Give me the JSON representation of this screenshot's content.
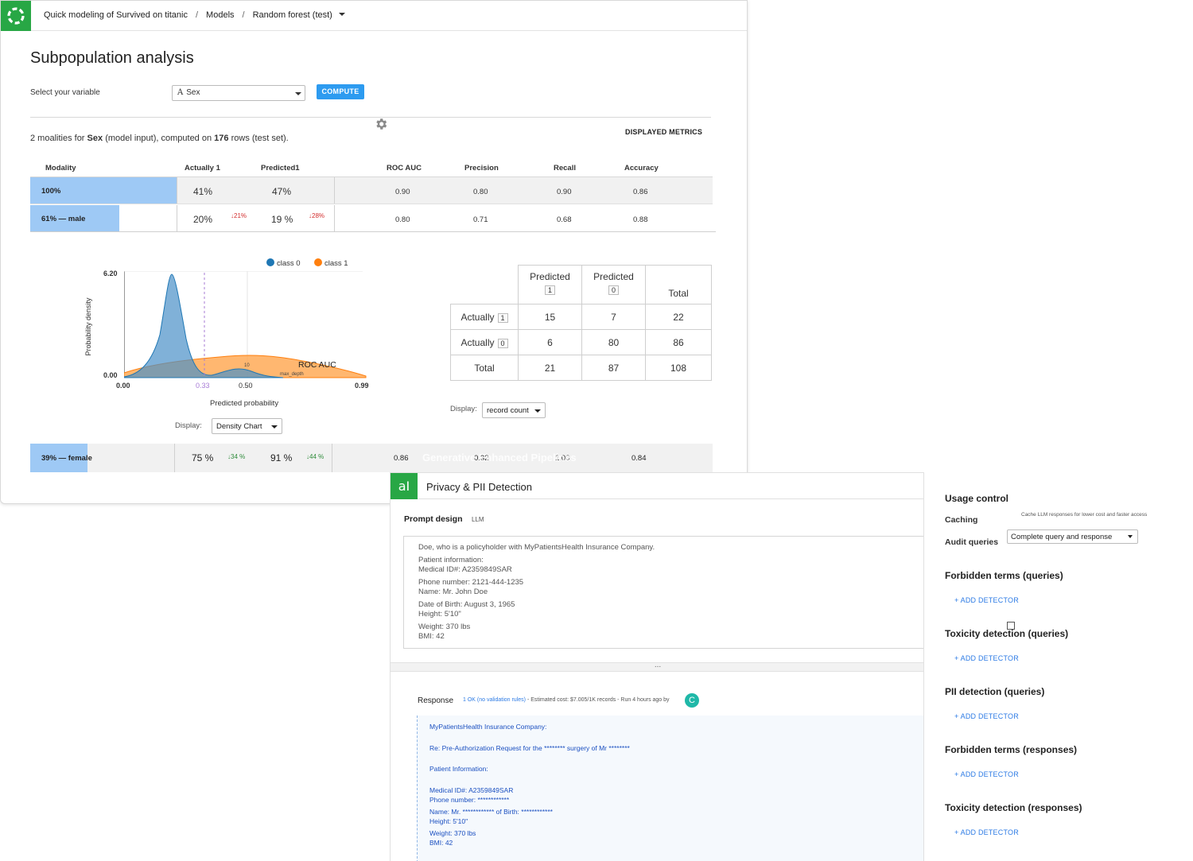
{
  "breadcrumb": {
    "project": "Quick modeling of Survived on titanic",
    "models": "Models",
    "model": "Random forest (test)"
  },
  "page_title": "Subpopulation analysis",
  "variable": {
    "label": "Select your variable",
    "selected": "Sex",
    "type_glyph": "A",
    "compute_label": "COMPUTE"
  },
  "displayed_metrics_label": "DISPLAYED METRICS",
  "summary": {
    "prefix": "2 moalities for",
    "variable": "Sex",
    "mid": "(model input), computed on",
    "rows": "176",
    "suffix": "rows (test set)."
  },
  "table": {
    "headers": [
      "Modality",
      "Actually 1",
      "Predicted1",
      "ROC AUC",
      "Precision",
      "Recall",
      "Accuracy"
    ],
    "rows": [
      {
        "modality": "100%",
        "share": 1.0,
        "actually1": "41%",
        "predicted1": "47%",
        "d_act": "",
        "d_pred": "",
        "roc_auc": "0.90",
        "precision": "0.80",
        "recall": "0.90",
        "accuracy": "0.86"
      },
      {
        "modality": "61% — male",
        "share": 0.61,
        "actually1": "20%",
        "predicted1": "19 %",
        "d_act": "↓21%",
        "d_pred": "↓28%",
        "roc_auc": "0.80",
        "precision": "0.71",
        "recall": "0.68",
        "accuracy": "0.88"
      },
      {
        "modality": "39% — female",
        "share": 0.39,
        "actually1": "75 %",
        "predicted1": "91 %",
        "d_act": "↓34 %",
        "d_pred": "↓44 %",
        "roc_auc": "0.86",
        "precision": "0.32",
        "recall": "1.00",
        "accuracy": "0.84"
      }
    ]
  },
  "density_chart": {
    "legend": [
      "class 0",
      "class 1"
    ],
    "colors": {
      "class0": "#1f77b4",
      "class1": "#ff7f0e",
      "threshold": "#a77bd6"
    },
    "y_label": "Probability density",
    "x_label": "Predicted probability",
    "y_ticks": [
      "6.20",
      "0.00"
    ],
    "x_ticks": [
      "0.00",
      "0.33",
      "0.50",
      "0.99"
    ],
    "annotations": [
      "ROC AUC",
      "10",
      "max_depth"
    ],
    "display_label": "Display:",
    "display_value": "Density Chart"
  },
  "confusion_matrix": {
    "col_headers": [
      {
        "label": "Predicted",
        "badge": "1"
      },
      {
        "label": "Predicted",
        "badge": "0"
      },
      {
        "label": "Total",
        "badge": ""
      }
    ],
    "rows": [
      {
        "label": "Actually",
        "badge": "1",
        "values": [
          "15",
          "7",
          "22"
        ]
      },
      {
        "label": "Actually",
        "badge": "0",
        "values": [
          "6",
          "80",
          "86"
        ]
      },
      {
        "label": "Total",
        "badge": "",
        "values": [
          "21",
          "87",
          "108"
        ]
      }
    ],
    "display_label": "Display:",
    "display_value": "record count"
  },
  "ghost_overlay_text": "Generative Enhanced Pipelines",
  "privacy_panel": {
    "title": "Privacy & PII Detection",
    "logo_glyph": "aI",
    "prompt_design_label": "Prompt design",
    "llm_tag": "LLM",
    "prompt_lines": [
      "Doe, who is a policyholder with MyPatientsHealth Insurance Company.",
      "Patient information:",
      "Medical ID#: A2359849SAR",
      "",
      "Phone number: 2121-444-1235",
      "Name: Mr. John Doe",
      "",
      "Date of Birth: August 3, 1965",
      "Height: 5'10\"",
      "",
      "Weight: 370 lbs",
      "BMI: 42"
    ],
    "splitter": "...",
    "response_label": "Response",
    "response_ok": "1 OK (no validation rules)",
    "response_meta": "- Estimated cost: $7.005/1K records - Run 4 hours ago by",
    "avatar_letter": "C",
    "response_lines": [
      "MyPatientsHealth Insurance Company:",
      "",
      "Re: Pre-Authorization Request for the ******** surgery of Mr ********",
      "",
      "Patient Information:",
      "",
      "Medical ID#: A2359849SAR",
      "Phone number: ************",
      "Name: Mr. ************ of Birth: ************",
      "Height: 5'10\"",
      "Weight: 370 lbs",
      "BMI: 42"
    ]
  },
  "usage_panel": {
    "title": "Usage control",
    "caching_label": "Caching",
    "caching_note": "Cache LLM responses for lower cost and faster access",
    "audit_label": "Audit queries",
    "audit_value": "Complete query and response",
    "sections": [
      "Forbidden terms (queries)",
      "Toxicity detection (queries)",
      "PII detection (queries)",
      "Forbidden terms (responses)",
      "Toxicity detection (responses)"
    ],
    "add_detector_label": "+ ADD DETECTOR"
  }
}
